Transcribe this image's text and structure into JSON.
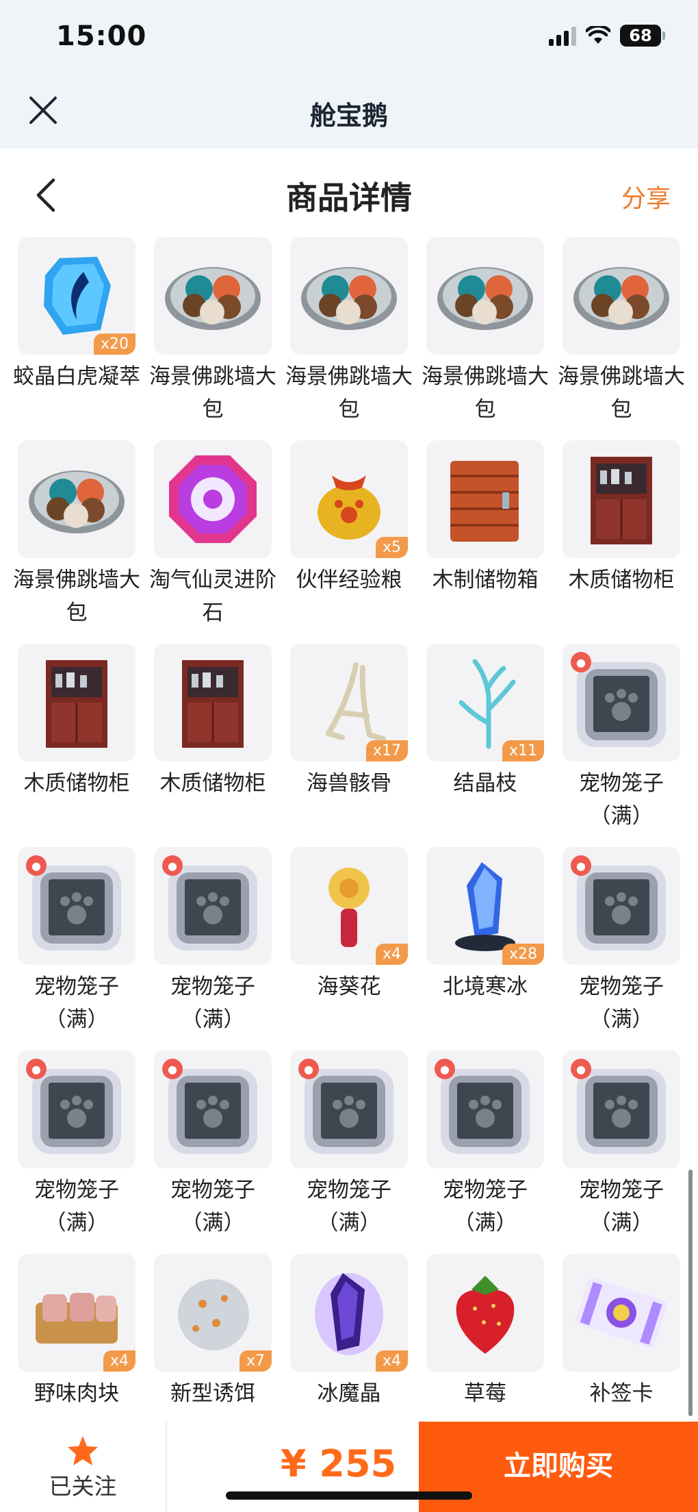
{
  "status": {
    "time": "15:00",
    "battery": "68"
  },
  "app": {
    "title": "舱宝鹅"
  },
  "header": {
    "title": "商品详情",
    "share_label": "分享"
  },
  "colors": {
    "accent": "#ff5b0f",
    "share": "#ee7a26",
    "qty_badge": "#f39a4a"
  },
  "items": [
    {
      "name": "蛟晶白虎凝萃",
      "qty": "x20",
      "icon": "gem-icon"
    },
    {
      "name": "海景佛跳墙大包",
      "qty": "",
      "icon": "dumpling-plate-icon"
    },
    {
      "name": "海景佛跳墙大包",
      "qty": "",
      "icon": "dumpling-plate-icon"
    },
    {
      "name": "海景佛跳墙大包",
      "qty": "",
      "icon": "dumpling-plate-icon"
    },
    {
      "name": "海景佛跳墙大包",
      "qty": "",
      "icon": "dumpling-plate-icon"
    },
    {
      "name": "海景佛跳墙大包",
      "qty": "",
      "icon": "dumpling-plate-icon"
    },
    {
      "name": "淘气仙灵进阶石",
      "qty": "",
      "icon": "octagon-stone-icon"
    },
    {
      "name": "伙伴经验粮",
      "qty": "x5",
      "icon": "food-bag-icon"
    },
    {
      "name": "木制储物箱",
      "qty": "",
      "icon": "wooden-box-icon"
    },
    {
      "name": "木质储物柜",
      "qty": "",
      "icon": "cabinet-icon"
    },
    {
      "name": "木质储物柜",
      "qty": "",
      "icon": "cabinet-icon"
    },
    {
      "name": "木质储物柜",
      "qty": "",
      "icon": "cabinet-icon"
    },
    {
      "name": "海兽骸骨",
      "qty": "x17",
      "icon": "bone-icon"
    },
    {
      "name": "结晶枝",
      "qty": "x11",
      "icon": "crystal-branch-icon"
    },
    {
      "name": "宠物笼子（满）",
      "qty": "",
      "icon": "pet-cage-icon"
    },
    {
      "name": "宠物笼子（满）",
      "qty": "",
      "icon": "pet-cage-icon"
    },
    {
      "name": "宠物笼子（满）",
      "qty": "",
      "icon": "pet-cage-icon"
    },
    {
      "name": "海葵花",
      "qty": "x4",
      "icon": "flower-icon"
    },
    {
      "name": "北境寒冰",
      "qty": "x28",
      "icon": "ice-crystal-icon"
    },
    {
      "name": "宠物笼子（满）",
      "qty": "",
      "icon": "pet-cage-icon"
    },
    {
      "name": "宠物笼子（满）",
      "qty": "",
      "icon": "pet-cage-icon"
    },
    {
      "name": "宠物笼子（满）",
      "qty": "",
      "icon": "pet-cage-icon"
    },
    {
      "name": "宠物笼子（满）",
      "qty": "",
      "icon": "pet-cage-icon"
    },
    {
      "name": "宠物笼子（满）",
      "qty": "",
      "icon": "pet-cage-icon"
    },
    {
      "name": "宠物笼子（满）",
      "qty": "",
      "icon": "pet-cage-icon"
    },
    {
      "name": "野味肉块",
      "qty": "x4",
      "icon": "meat-icon"
    },
    {
      "name": "新型诱饵",
      "qty": "x7",
      "icon": "bait-icon"
    },
    {
      "name": "冰魔晶",
      "qty": "x4",
      "icon": "purple-crystal-icon"
    },
    {
      "name": "草莓",
      "qty": "",
      "icon": "strawberry-icon"
    },
    {
      "name": "补签卡",
      "qty": "",
      "icon": "ticket-icon"
    }
  ],
  "bottom": {
    "follow_label": "已关注",
    "price": "¥ 255",
    "buy_label": "立即购买"
  }
}
